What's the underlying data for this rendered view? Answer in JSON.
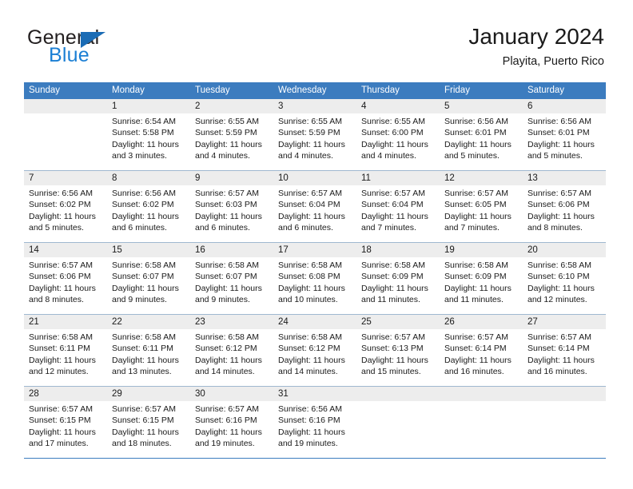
{
  "brand": {
    "name_top": "General",
    "name_bottom": "Blue",
    "triangle_color": "#1b6cb5",
    "blue_color": "#1b7fd4"
  },
  "header": {
    "title": "January 2024",
    "subtitle": "Playita, Puerto Rico"
  },
  "theme": {
    "header_bar": "#3c7cbf",
    "day_band": "#ededed",
    "row_rule": "#9fb8d0",
    "text": "#1a1a1a"
  },
  "weekdays": [
    "Sunday",
    "Monday",
    "Tuesday",
    "Wednesday",
    "Thursday",
    "Friday",
    "Saturday"
  ],
  "weeks": [
    [
      {
        "day": "",
        "empty": true,
        "sunrise": "",
        "sunset": "",
        "daylight_1": "",
        "daylight_2": ""
      },
      {
        "day": "1",
        "sunrise": "Sunrise: 6:54 AM",
        "sunset": "Sunset: 5:58 PM",
        "daylight_1": "Daylight: 11 hours",
        "daylight_2": "and 3 minutes."
      },
      {
        "day": "2",
        "sunrise": "Sunrise: 6:55 AM",
        "sunset": "Sunset: 5:59 PM",
        "daylight_1": "Daylight: 11 hours",
        "daylight_2": "and 4 minutes."
      },
      {
        "day": "3",
        "sunrise": "Sunrise: 6:55 AM",
        "sunset": "Sunset: 5:59 PM",
        "daylight_1": "Daylight: 11 hours",
        "daylight_2": "and 4 minutes."
      },
      {
        "day": "4",
        "sunrise": "Sunrise: 6:55 AM",
        "sunset": "Sunset: 6:00 PM",
        "daylight_1": "Daylight: 11 hours",
        "daylight_2": "and 4 minutes."
      },
      {
        "day": "5",
        "sunrise": "Sunrise: 6:56 AM",
        "sunset": "Sunset: 6:01 PM",
        "daylight_1": "Daylight: 11 hours",
        "daylight_2": "and 5 minutes."
      },
      {
        "day": "6",
        "sunrise": "Sunrise: 6:56 AM",
        "sunset": "Sunset: 6:01 PM",
        "daylight_1": "Daylight: 11 hours",
        "daylight_2": "and 5 minutes."
      }
    ],
    [
      {
        "day": "7",
        "sunrise": "Sunrise: 6:56 AM",
        "sunset": "Sunset: 6:02 PM",
        "daylight_1": "Daylight: 11 hours",
        "daylight_2": "and 5 minutes."
      },
      {
        "day": "8",
        "sunrise": "Sunrise: 6:56 AM",
        "sunset": "Sunset: 6:02 PM",
        "daylight_1": "Daylight: 11 hours",
        "daylight_2": "and 6 minutes."
      },
      {
        "day": "9",
        "sunrise": "Sunrise: 6:57 AM",
        "sunset": "Sunset: 6:03 PM",
        "daylight_1": "Daylight: 11 hours",
        "daylight_2": "and 6 minutes."
      },
      {
        "day": "10",
        "sunrise": "Sunrise: 6:57 AM",
        "sunset": "Sunset: 6:04 PM",
        "daylight_1": "Daylight: 11 hours",
        "daylight_2": "and 6 minutes."
      },
      {
        "day": "11",
        "sunrise": "Sunrise: 6:57 AM",
        "sunset": "Sunset: 6:04 PM",
        "daylight_1": "Daylight: 11 hours",
        "daylight_2": "and 7 minutes."
      },
      {
        "day": "12",
        "sunrise": "Sunrise: 6:57 AM",
        "sunset": "Sunset: 6:05 PM",
        "daylight_1": "Daylight: 11 hours",
        "daylight_2": "and 7 minutes."
      },
      {
        "day": "13",
        "sunrise": "Sunrise: 6:57 AM",
        "sunset": "Sunset: 6:06 PM",
        "daylight_1": "Daylight: 11 hours",
        "daylight_2": "and 8 minutes."
      }
    ],
    [
      {
        "day": "14",
        "sunrise": "Sunrise: 6:57 AM",
        "sunset": "Sunset: 6:06 PM",
        "daylight_1": "Daylight: 11 hours",
        "daylight_2": "and 8 minutes."
      },
      {
        "day": "15",
        "sunrise": "Sunrise: 6:58 AM",
        "sunset": "Sunset: 6:07 PM",
        "daylight_1": "Daylight: 11 hours",
        "daylight_2": "and 9 minutes."
      },
      {
        "day": "16",
        "sunrise": "Sunrise: 6:58 AM",
        "sunset": "Sunset: 6:07 PM",
        "daylight_1": "Daylight: 11 hours",
        "daylight_2": "and 9 minutes."
      },
      {
        "day": "17",
        "sunrise": "Sunrise: 6:58 AM",
        "sunset": "Sunset: 6:08 PM",
        "daylight_1": "Daylight: 11 hours",
        "daylight_2": "and 10 minutes."
      },
      {
        "day": "18",
        "sunrise": "Sunrise: 6:58 AM",
        "sunset": "Sunset: 6:09 PM",
        "daylight_1": "Daylight: 11 hours",
        "daylight_2": "and 11 minutes."
      },
      {
        "day": "19",
        "sunrise": "Sunrise: 6:58 AM",
        "sunset": "Sunset: 6:09 PM",
        "daylight_1": "Daylight: 11 hours",
        "daylight_2": "and 11 minutes."
      },
      {
        "day": "20",
        "sunrise": "Sunrise: 6:58 AM",
        "sunset": "Sunset: 6:10 PM",
        "daylight_1": "Daylight: 11 hours",
        "daylight_2": "and 12 minutes."
      }
    ],
    [
      {
        "day": "21",
        "sunrise": "Sunrise: 6:58 AM",
        "sunset": "Sunset: 6:11 PM",
        "daylight_1": "Daylight: 11 hours",
        "daylight_2": "and 12 minutes."
      },
      {
        "day": "22",
        "sunrise": "Sunrise: 6:58 AM",
        "sunset": "Sunset: 6:11 PM",
        "daylight_1": "Daylight: 11 hours",
        "daylight_2": "and 13 minutes."
      },
      {
        "day": "23",
        "sunrise": "Sunrise: 6:58 AM",
        "sunset": "Sunset: 6:12 PM",
        "daylight_1": "Daylight: 11 hours",
        "daylight_2": "and 14 minutes."
      },
      {
        "day": "24",
        "sunrise": "Sunrise: 6:58 AM",
        "sunset": "Sunset: 6:12 PM",
        "daylight_1": "Daylight: 11 hours",
        "daylight_2": "and 14 minutes."
      },
      {
        "day": "25",
        "sunrise": "Sunrise: 6:57 AM",
        "sunset": "Sunset: 6:13 PM",
        "daylight_1": "Daylight: 11 hours",
        "daylight_2": "and 15 minutes."
      },
      {
        "day": "26",
        "sunrise": "Sunrise: 6:57 AM",
        "sunset": "Sunset: 6:14 PM",
        "daylight_1": "Daylight: 11 hours",
        "daylight_2": "and 16 minutes."
      },
      {
        "day": "27",
        "sunrise": "Sunrise: 6:57 AM",
        "sunset": "Sunset: 6:14 PM",
        "daylight_1": "Daylight: 11 hours",
        "daylight_2": "and 16 minutes."
      }
    ],
    [
      {
        "day": "28",
        "sunrise": "Sunrise: 6:57 AM",
        "sunset": "Sunset: 6:15 PM",
        "daylight_1": "Daylight: 11 hours",
        "daylight_2": "and 17 minutes."
      },
      {
        "day": "29",
        "sunrise": "Sunrise: 6:57 AM",
        "sunset": "Sunset: 6:15 PM",
        "daylight_1": "Daylight: 11 hours",
        "daylight_2": "and 18 minutes."
      },
      {
        "day": "30",
        "sunrise": "Sunrise: 6:57 AM",
        "sunset": "Sunset: 6:16 PM",
        "daylight_1": "Daylight: 11 hours",
        "daylight_2": "and 19 minutes."
      },
      {
        "day": "31",
        "sunrise": "Sunrise: 6:56 AM",
        "sunset": "Sunset: 6:16 PM",
        "daylight_1": "Daylight: 11 hours",
        "daylight_2": "and 19 minutes."
      },
      {
        "day": "",
        "empty": true,
        "sunrise": "",
        "sunset": "",
        "daylight_1": "",
        "daylight_2": ""
      },
      {
        "day": "",
        "empty": true,
        "sunrise": "",
        "sunset": "",
        "daylight_1": "",
        "daylight_2": ""
      },
      {
        "day": "",
        "empty": true,
        "sunrise": "",
        "sunset": "",
        "daylight_1": "",
        "daylight_2": ""
      }
    ]
  ]
}
